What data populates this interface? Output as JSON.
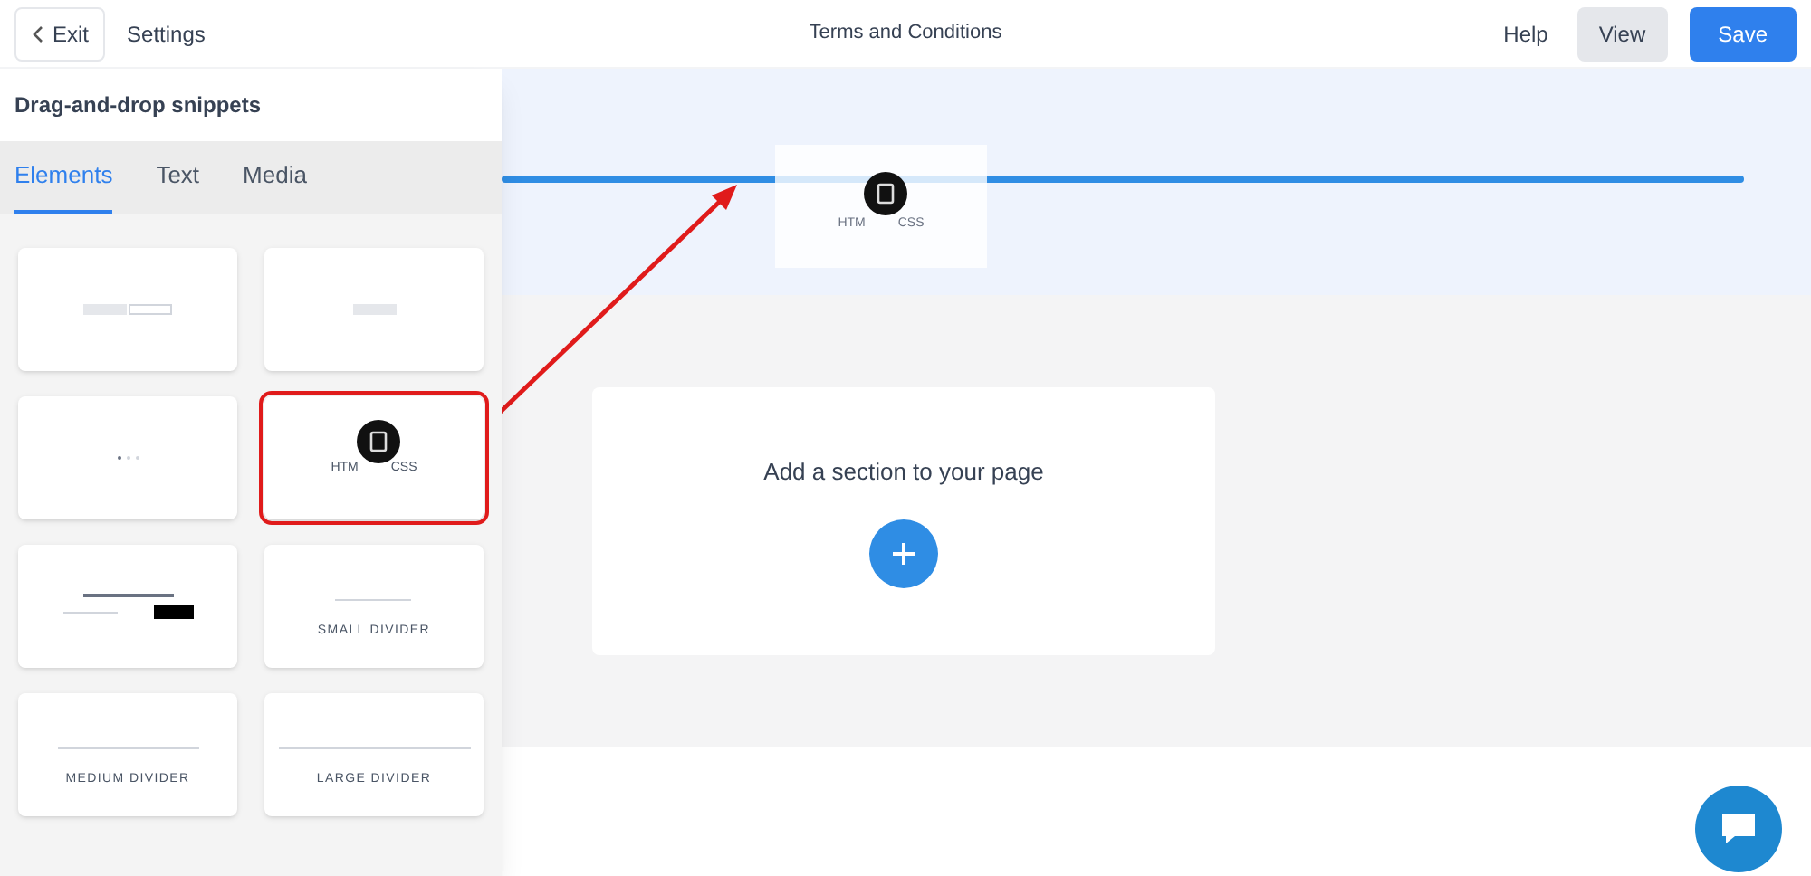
{
  "header": {
    "exit": "Exit",
    "settings": "Settings",
    "title": "Terms and Conditions",
    "help": "Help",
    "view": "View",
    "save": "Save"
  },
  "panel": {
    "title": "Drag-and-drop snippets",
    "tabs": [
      {
        "label": "Elements",
        "selected": true
      },
      {
        "label": "Text",
        "selected": false
      },
      {
        "label": "Media",
        "selected": false
      }
    ],
    "snippets": [
      {
        "kind": "buttons"
      },
      {
        "kind": "button"
      },
      {
        "kind": "dots"
      },
      {
        "kind": "html",
        "label_start": "HTM",
        "label_end": "CSS",
        "highlighted": true
      },
      {
        "kind": "newsletter"
      },
      {
        "kind": "divider",
        "label": "SMALL DIVIDER"
      },
      {
        "kind": "divider",
        "label": "MEDIUM DIVIDER"
      },
      {
        "kind": "divider",
        "label": "LARGE DIVIDER"
      }
    ]
  },
  "canvas": {
    "ghost": {
      "label_start": "HTM",
      "label_end": "CSS"
    },
    "empty_card": {
      "text": "Add a section to your page"
    }
  }
}
